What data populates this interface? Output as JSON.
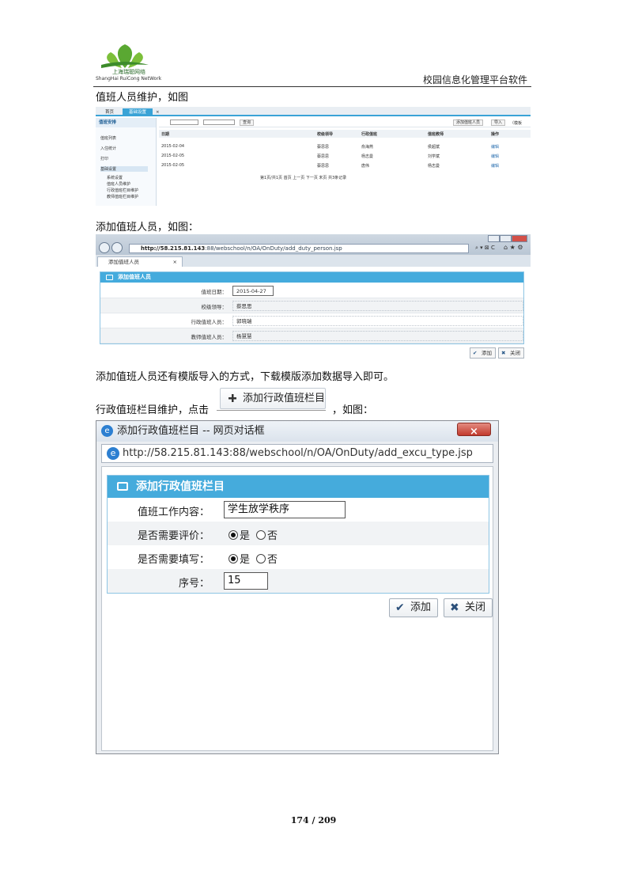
{
  "header": {
    "logo_cn": "上海瑞聪网络",
    "logo_en": "ShangHai RuiCong NetWork",
    "title": "校园信息化管理平台软件"
  },
  "paragraphs": {
    "p1": "值班人员维护，如图",
    "p2": "添加值班人员，如图：",
    "p3": "添加值班人员还有模版导入的方式，下载模版添加数据导入即可。",
    "p4_before": "行政值班栏目维护，点击",
    "p4_after": "，如图："
  },
  "inline_button": "添加行政值班栏目",
  "shot1": {
    "tabs": [
      "首页",
      "基础设置",
      "×"
    ],
    "sidebar_title": "值班安排",
    "sidebar_items": [
      "值班列表",
      "入住统计",
      "打印",
      "基础设置"
    ],
    "sidebar_sub": [
      "系统设置",
      "值班人员维护",
      "行政值班栏目维护",
      "教师值班栏目维护"
    ],
    "toolbar": {
      "query": "查询",
      "add": "添加值班人员",
      "import": "导入",
      "other": "（模板"
    },
    "columns": [
      "日期",
      "校级领导",
      "行政值班",
      "值班教师",
      "操作"
    ],
    "rows": [
      [
        "2015-02-04",
        "蔡思思",
        "俞海燕",
        "侯超斌",
        "编辑"
      ],
      [
        "2015-02-05",
        "蔡思思",
        "杨志曼",
        "刘学斌",
        "编辑"
      ],
      [
        "2015-02-05",
        "蔡思思",
        "唐伟",
        "杨志曼",
        "编辑"
      ]
    ],
    "pager": "第1页/共1页 首页 上一页 下一页 末页 共3条记录"
  },
  "shot2": {
    "url_host": "http://58.215.81.143",
    "url_path": ":88/webschool/n/OA/OnDuty/add_duty_person.jsp",
    "tab_label": "添加值班人员",
    "panel_title": "添加值班人员",
    "fields": [
      {
        "label": "值班日期：",
        "value": "2015-04-27"
      },
      {
        "label": "校级领导：",
        "value": "蔡思思"
      },
      {
        "label": "行政值班人员：",
        "value": "郭晓瑞"
      },
      {
        "label": "教师值班人员：",
        "value": "杨慧慧"
      }
    ],
    "btn_add": "添加",
    "btn_close": "关闭"
  },
  "dialog": {
    "title": "添加行政值班栏目 -- 网页对话框",
    "url": "http://58.215.81.143:88/webschool/n/OA/OnDuty/add_excu_type.jsp",
    "panel_title": "添加行政值班栏目",
    "rows": {
      "content_label": "值班工作内容：",
      "content_value": "学生放学秩序",
      "eval_label": "是否需要评价：",
      "fill_label": "是否需要填写：",
      "yes": "是",
      "no": "否",
      "seq_label": "序号：",
      "seq_value": "15"
    },
    "btn_add": "添加",
    "btn_close": "关闭"
  },
  "page_number": "174 / 209"
}
